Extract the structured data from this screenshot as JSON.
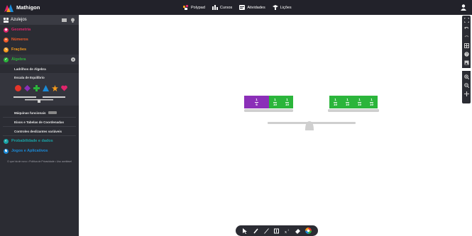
{
  "app": {
    "name": "Mathigon"
  },
  "nav": [
    {
      "label": "Polypad",
      "icon": "polypad-icon"
    },
    {
      "label": "Cursos",
      "icon": "courses-icon"
    },
    {
      "label": "Atividades",
      "icon": "activities-icon"
    },
    {
      "label": "Lições",
      "icon": "lessons-icon"
    }
  ],
  "sidebar": {
    "header": "Azulejos",
    "categories": [
      {
        "label": "Geometria",
        "color": "#e0246b"
      },
      {
        "label": "Números",
        "color": "#f05a28"
      },
      {
        "label": "Frações",
        "color": "#f59a1b"
      },
      {
        "label": "Álgebra",
        "color": "#2bb53b"
      }
    ],
    "algebra_items": [
      "Ladrilhos de Álgebra",
      "Escala de Equilíbrio",
      "Máquinas funcionais",
      "Eixos e Tabelas de Coordenadas",
      "Controles deslizantes variáveis"
    ],
    "more_categories": [
      {
        "label": "Probabilidade e dados",
        "color": "#19a3a6"
      },
      {
        "label": "Jogos e Aplicativos",
        "color": "#1a8ad8"
      }
    ],
    "footer": "O que há de novo • Política de Privacidade • Uso aceitável"
  },
  "balance": {
    "left_tiles": [
      {
        "num": "1",
        "den": "5",
        "color": "#8b2fb8"
      },
      {
        "num": "1",
        "den": "10",
        "color": "#2bb53b"
      },
      {
        "num": "1",
        "den": "10",
        "color": "#2bb53b"
      }
    ],
    "right_tiles": [
      {
        "num": "1",
        "den": "10",
        "color": "#2bb53b"
      },
      {
        "num": "1",
        "den": "10",
        "color": "#2bb53b"
      },
      {
        "num": "1",
        "den": "10",
        "color": "#2bb53b"
      },
      {
        "num": "1",
        "den": "10",
        "color": "#2bb53b"
      }
    ]
  },
  "colors": {
    "topbar": "#22222a",
    "sidebar": "#2b2c33",
    "algebra": "#2bb53b",
    "fraction_fifth": "#8b2fb8"
  }
}
